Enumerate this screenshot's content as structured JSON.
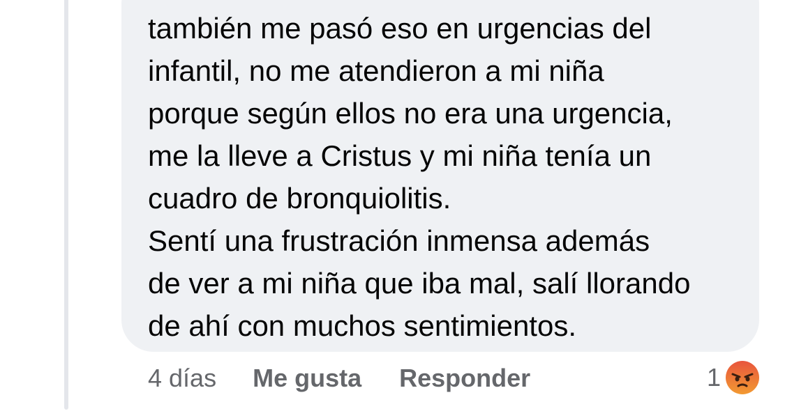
{
  "comment": {
    "text": "también me pasó eso en urgencias del\ninfantil, no me atendieron a mi niña\nporque según ellos no era una urgencia,\nme la lleve a Cristus y mi niña tenía un\ncuadro de bronquiolitis.\nSentí una frustración inmensa además\nde ver a mi niña que iba mal, salí llorando\nde ahí con muchos sentimientos."
  },
  "actions": {
    "timestamp": "4 días",
    "like_label": "Me gusta",
    "reply_label": "Responder"
  },
  "reactions": {
    "count": "1",
    "icon": "angry-reaction-icon"
  },
  "colors": {
    "bubble_bg": "#eff1f4",
    "text": "#050505",
    "secondary_text": "#65676b",
    "angry_top": "#f29a32",
    "angry_bottom": "#e8553d"
  }
}
